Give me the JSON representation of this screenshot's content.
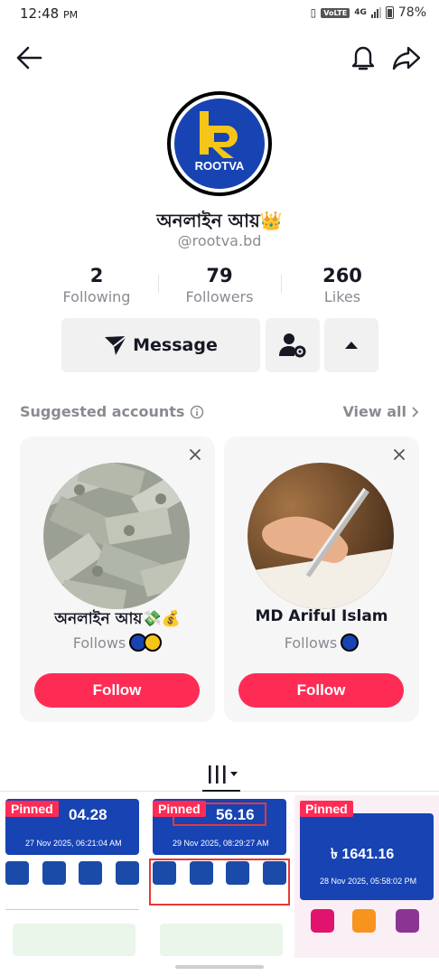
{
  "status_bar": {
    "time": "12:48",
    "ampm": "PM",
    "volte": "VoLTE",
    "network": "4G",
    "battery": "78%"
  },
  "profile": {
    "display_name": "অনলাইন আয়👑",
    "username": "@rootva.bd",
    "avatar_logo_text": "ROOTVA"
  },
  "stats": [
    {
      "value": "2",
      "label": "Following"
    },
    {
      "value": "79",
      "label": "Followers"
    },
    {
      "value": "260",
      "label": "Likes"
    }
  ],
  "actions": {
    "message_label": "Message"
  },
  "suggested": {
    "title": "Suggested accounts",
    "view_all": "View all",
    "accounts": [
      {
        "name": "অনলাইন আয়💸💰",
        "follows_text": "Follows",
        "button": "Follow"
      },
      {
        "name": "MD Ariful Islam",
        "follows_text": "Follows",
        "button": "Follow"
      }
    ]
  },
  "videos": [
    {
      "pinned_label": "Pinned",
      "amount": "04.28",
      "date": "27 Nov 2025, 06:21:04 AM"
    },
    {
      "pinned_label": "Pinned",
      "amount": "56.16",
      "date": "29 Nov 2025, 08:29:27 AM"
    },
    {
      "pinned_label": "Pinned",
      "amount": "৳ 1641.16",
      "date": "28 Nov 2025, 05:58:02 PM"
    }
  ],
  "colors": {
    "accent": "#fe2c55",
    "brand_blue": "#1743b3",
    "muted_text": "#8a8b91",
    "button_grey": "#f1f1f2"
  }
}
